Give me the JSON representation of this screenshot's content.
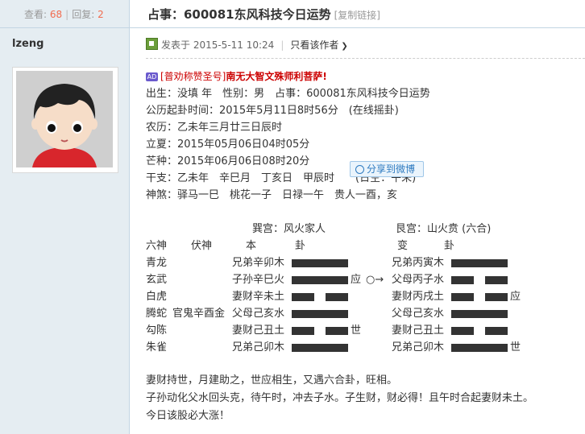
{
  "sidebar": {
    "views_label": "查看:",
    "views": "68",
    "replies_label": "回复:",
    "replies": "2",
    "author": "lzeng"
  },
  "post": {
    "title": "占事：600081东风科技今日运势",
    "copy_link": "[复制链接]",
    "posted_at": "发表于 2015-5-11 10:24",
    "only_author": "只看该作者",
    "ad_badge": "AD",
    "ad_link": "[普劝称赞圣号]",
    "ad_text": "南无大智文殊师利菩萨!",
    "info_lines": [
      "出生：没填 年　性别：男　占事：600081东风科技今日运势",
      "公历起卦时间：2015年5月11日8时56分　(在线摇卦)",
      "农历：乙未年三月廿三日辰时",
      "立夏：2015年05月06日04时05分",
      "芒种：2015年06月06日08时20分",
      "干支：乙未年　辛巳月　丁亥日　甲辰时　　(日空：午未)",
      "神煞：驿马一巳　桃花一子　日禄一午　贵人一酉，亥"
    ],
    "gua_left_title": "巽宫：风火家人",
    "gua_right_title": "艮宫：山火贲 (六合)",
    "header": {
      "liushen": "六神",
      "fushen": "伏神",
      "ben": "本",
      "gua1": "卦",
      "bian": "变",
      "gua2": "卦"
    },
    "lines": [
      {
        "god": "青龙",
        "fu": "",
        "left": "兄弟辛卯木",
        "mark": "",
        "change": "",
        "right": "兄弟丙寅木",
        "rmark": ""
      },
      {
        "god": "玄武",
        "fu": "",
        "left": "子孙辛巳火",
        "mark": "应",
        "change": "○→",
        "right": "父母丙子水",
        "rmark": ""
      },
      {
        "god": "白虎",
        "fu": "",
        "left": "妻财辛未土",
        "mark": "",
        "change": "",
        "right": "妻财丙戌土",
        "rmark": "应"
      },
      {
        "god": "腾蛇",
        "fu": "官鬼辛酉金",
        "left": "父母己亥水",
        "mark": "",
        "change": "",
        "right": "父母己亥水",
        "rmark": ""
      },
      {
        "god": "勾陈",
        "fu": "",
        "left": "妻财己丑土",
        "mark": "世",
        "change": "",
        "right": "妻财己丑土",
        "rmark": ""
      },
      {
        "god": "朱雀",
        "fu": "",
        "left": "兄弟己卯木",
        "mark": "",
        "change": "",
        "right": "兄弟己卯木",
        "rmark": "世"
      }
    ],
    "share_label": "分享到微博",
    "summary": [
      "妻财持世，月建助之，世应相生，又遇六合卦，旺相。",
      "子孙动化父水回头克，待午时，冲去子水。子生财，财必得！且午时合起妻财未土。",
      "今日该股必大涨！"
    ]
  }
}
